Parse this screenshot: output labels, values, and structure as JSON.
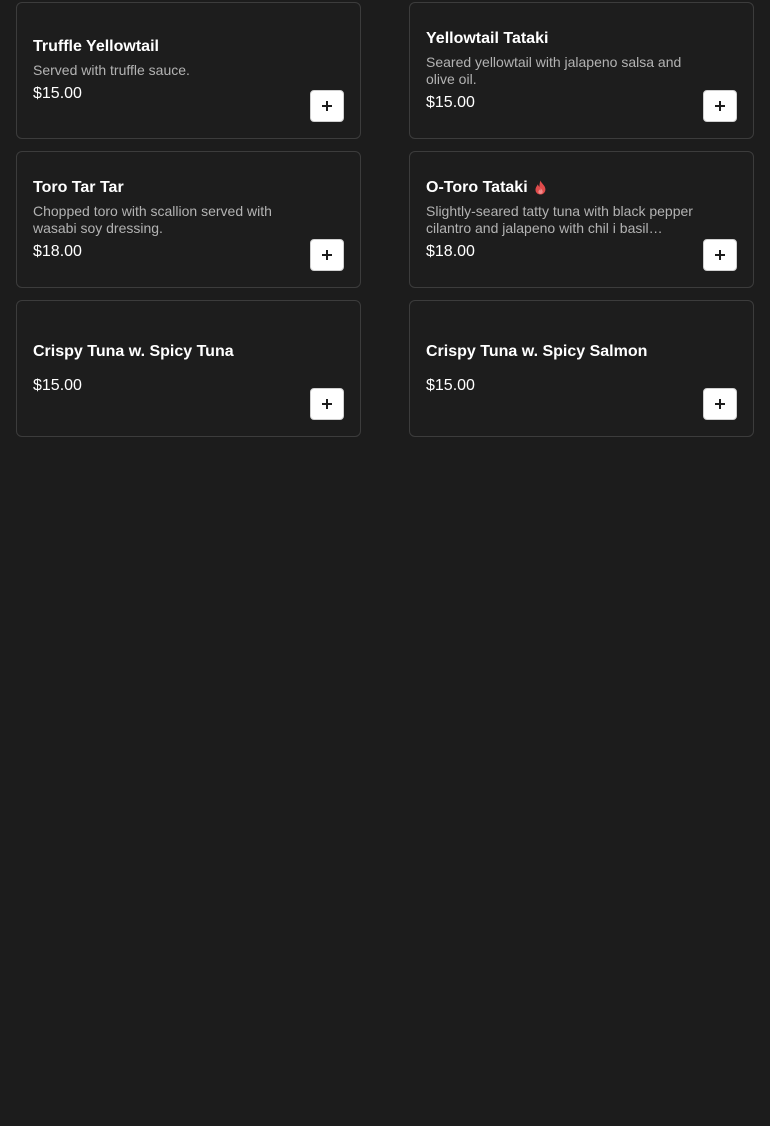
{
  "theme": {
    "background": "#1c1c1c",
    "card_border": "#3c3c3c",
    "spicy_color": "#e04b4b"
  },
  "items": [
    {
      "title": "Truffle Yellowtail",
      "description": "Served with truffle sauce.",
      "price": "$15.00",
      "add_icon": "plus-icon"
    },
    {
      "title": "Yellowtail Tataki",
      "description": "Seared yellowtail with jalapeno salsa and olive oil.",
      "price": "$15.00",
      "add_icon": "plus-icon"
    },
    {
      "title": "Toro Tar Tar",
      "description": "Chopped toro with scallion served with wasabi soy dressing.",
      "price": "$18.00",
      "add_icon": "plus-icon"
    },
    {
      "title": "O-Toro Tataki",
      "badge_icon": "spicy-flame-icon",
      "description": "Slightly-seared tatty tuna with black pepper cilantro and jalapeno with chil i basil sauce.…",
      "price": "$18.00",
      "add_icon": "plus-icon"
    },
    {
      "title": "Crispy Tuna w. Spicy Tuna",
      "description": "",
      "price": "$15.00",
      "add_icon": "plus-icon"
    },
    {
      "title": "Crispy Tuna w. Spicy Salmon",
      "description": "",
      "price": "$15.00",
      "add_icon": "plus-icon"
    }
  ]
}
